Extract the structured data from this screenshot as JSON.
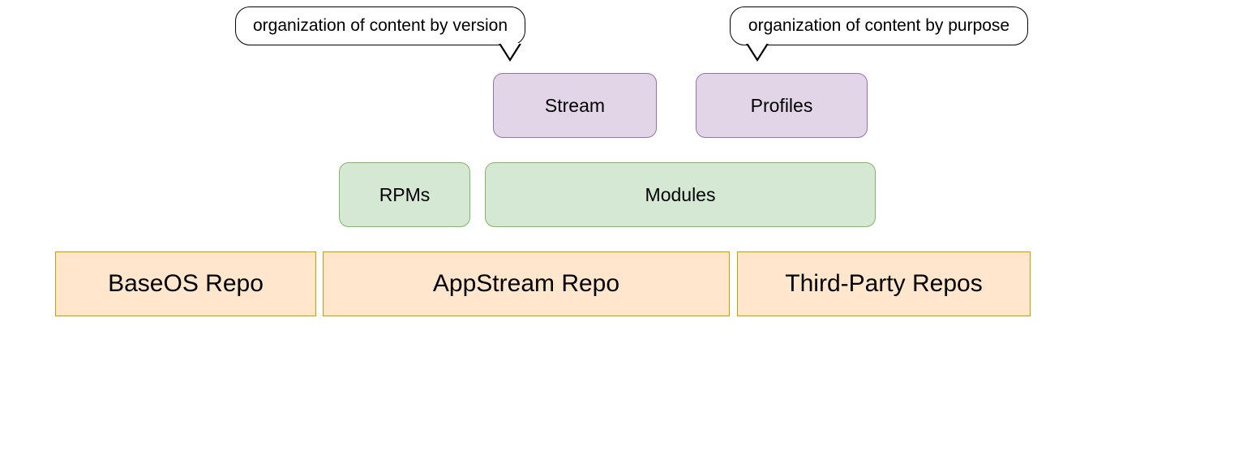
{
  "repos": {
    "baseos": "BaseOS Repo",
    "appstream": "AppStream Repo",
    "thirdparty": "Third-Party Repos"
  },
  "packages": {
    "rpms": "RPMs",
    "modules": "Modules"
  },
  "module_subs": {
    "stream": "Stream",
    "profiles": "Profiles"
  },
  "tooltips": {
    "stream": "organization of content by version",
    "profiles": "organization of content by purpose"
  }
}
